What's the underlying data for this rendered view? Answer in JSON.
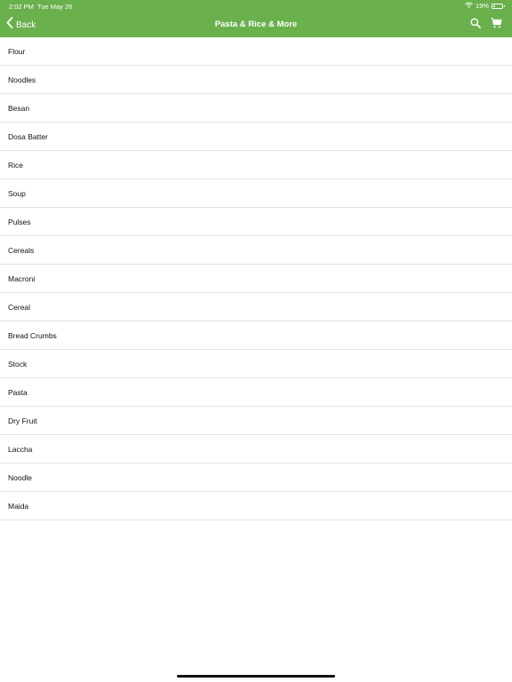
{
  "status_bar": {
    "time": "2:02 PM",
    "date": "Tue May 26",
    "battery_percent_label": "19%",
    "battery_level": 0.19,
    "wifi_icon": "wifi-icon",
    "battery_icon": "battery-icon"
  },
  "nav": {
    "back_label": "Back",
    "back_icon": "chevron-left-icon",
    "title": "Pasta & Rice & More",
    "search_icon": "search-icon",
    "cart_icon": "cart-icon"
  },
  "colors": {
    "header_background": "#6ab04c",
    "header_text": "#ffffff",
    "divider": "#e3e3e3",
    "body_background": "#ffffff"
  },
  "items": [
    "Flour",
    "Noodles",
    "Besan",
    "Dosa Batter",
    "Rice",
    "Soup",
    "Pulses",
    "Cereals",
    "Macroni",
    "Cereal",
    "Bread Crumbs",
    "Stock",
    "Pasta",
    "Dry Fruit",
    "Laccha",
    "Noodle",
    "Maida"
  ]
}
